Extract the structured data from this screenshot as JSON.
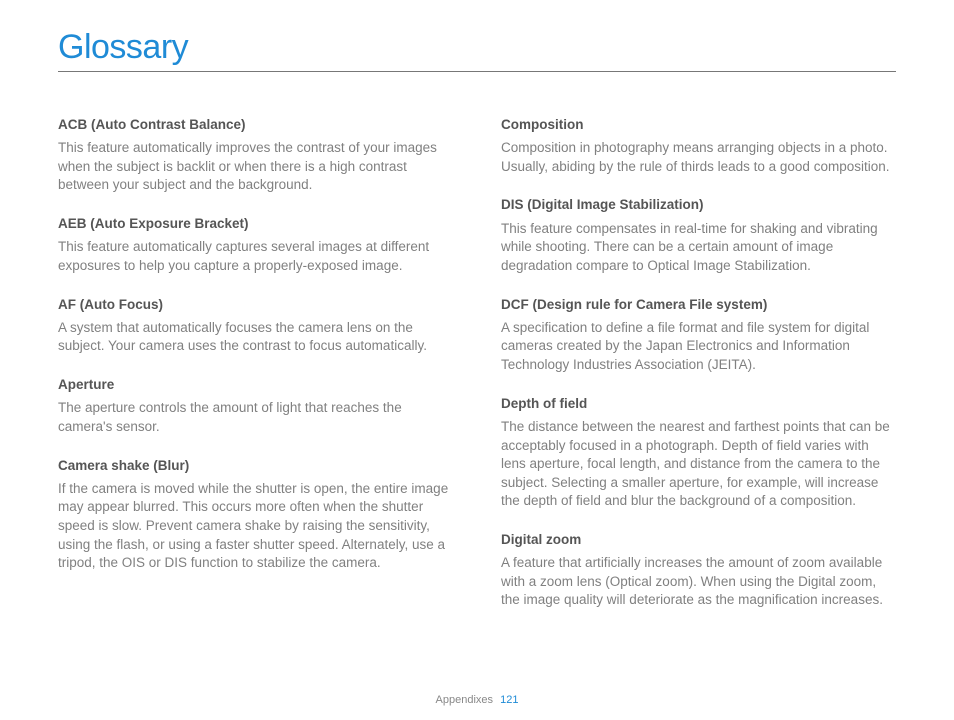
{
  "title": "Glossary",
  "left": [
    {
      "term": "ACB (Auto Contrast Balance)",
      "def": "This feature automatically improves the contrast of your images when the subject is backlit or when there is a high contrast between your subject and the background."
    },
    {
      "term": "AEB (Auto Exposure Bracket)",
      "def": "This feature automatically captures several images at different exposures to help you capture a properly-exposed image."
    },
    {
      "term": "AF (Auto Focus)",
      "def": "A system that automatically focuses the camera lens on the subject. Your camera uses the contrast to focus automatically."
    },
    {
      "term": "Aperture",
      "def": "The aperture controls the amount of light that reaches the camera's sensor."
    },
    {
      "term": "Camera shake (Blur)",
      "def": "If the camera is moved while the shutter is open, the entire image may appear blurred. This occurs more often when the shutter speed is slow. Prevent camera shake by raising the sensitivity, using the flash, or using a faster shutter speed. Alternately, use a tripod, the OIS or DIS function to stabilize the camera."
    }
  ],
  "right": [
    {
      "term": "Composition",
      "def": "Composition in photography means arranging objects in a photo. Usually, abiding by the rule of thirds leads to a good composition."
    },
    {
      "term": "DIS (Digital Image Stabilization)",
      "def": "This feature compensates in real-time for shaking and vibrating while shooting. There can be a certain amount of image degradation compare to Optical Image Stabilization."
    },
    {
      "term": "DCF (Design rule for Camera File system)",
      "def": "A specification to define a file format and file system for digital cameras created by the Japan Electronics and Information Technology Industries Association (JEITA)."
    },
    {
      "term": "Depth of field",
      "def": "The distance between the nearest and farthest points that can be acceptably focused in a photograph. Depth of field varies with lens aperture, focal length, and distance from the camera to the subject. Selecting a smaller aperture, for example, will increase the depth of field and blur the background of a composition."
    },
    {
      "term": "Digital zoom",
      "def": "A feature that artificially increases the amount of zoom available with a zoom lens (Optical zoom). When using the Digital zoom, the image quality will deteriorate as the magnification increases."
    }
  ],
  "footer": {
    "section": "Appendixes",
    "page": "121"
  }
}
